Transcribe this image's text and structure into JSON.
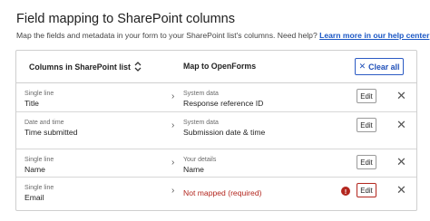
{
  "page": {
    "title": "Field mapping to SharePoint columns",
    "subtitle": "Map the fields and metadata in your form to your SharePoint list's columns. Need help?",
    "help_link": "Learn more in our help center"
  },
  "table": {
    "col_sharepoint": "Columns in SharePoint list",
    "col_openforms": "Map to OpenForms",
    "clear_all_label": "Clear all",
    "clear_icon": "✕",
    "chevron": "›",
    "edit_label": "Edit",
    "remove_glyph": "✕",
    "error_glyph": "!",
    "rows": [
      {
        "sp_type": "Single line",
        "sp_name": "Title",
        "of_type": "System data",
        "of_name": "Response reference ID",
        "error": ""
      },
      {
        "sp_type": "Date and time",
        "sp_name": "Time submitted",
        "of_type": "System data",
        "of_name": "Submission date & time",
        "error": ""
      },
      {
        "sp_type": "Single line",
        "sp_name": "Name",
        "of_type": "Your details",
        "of_name": "Name",
        "error": ""
      },
      {
        "sp_type": "Single line",
        "sp_name": "Email",
        "of_type": "",
        "of_name": "",
        "error": "Not mapped (required)"
      }
    ]
  },
  "colors": {
    "accent": "#1f4fb8",
    "error": "#b3261e",
    "border": "#cfcfcf"
  }
}
